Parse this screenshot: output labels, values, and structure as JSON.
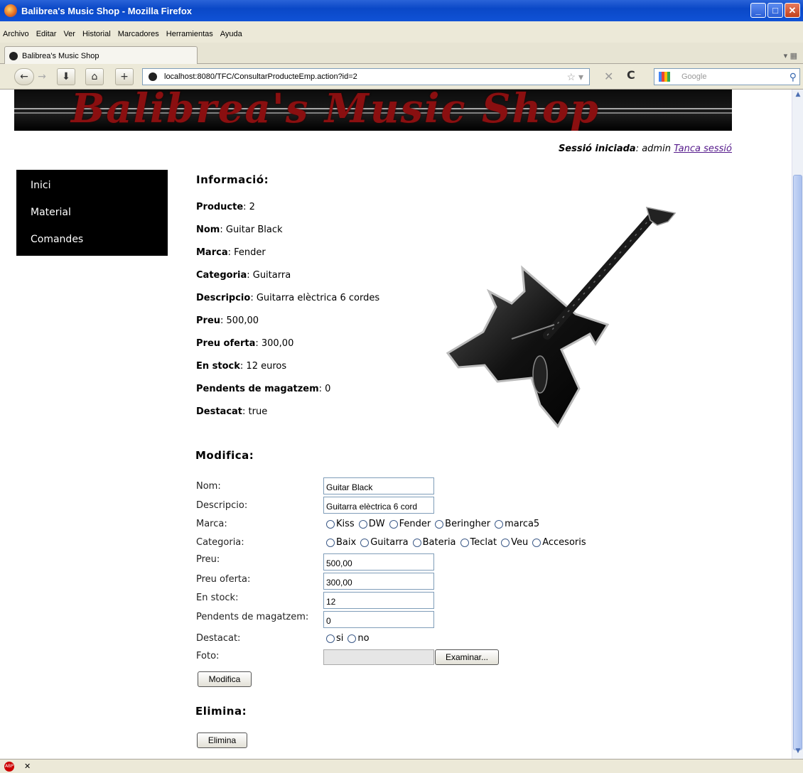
{
  "window": {
    "title": "Balibrea's Music Shop - Mozilla Firefox"
  },
  "menu": [
    "Archivo",
    "Editar",
    "Ver",
    "Historial",
    "Marcadores",
    "Herramientas",
    "Ayuda"
  ],
  "tab": {
    "label": "Balibrea's Music Shop"
  },
  "address": {
    "url": "localhost:8080/TFC/ConsultarProducteEmp.action?id=2"
  },
  "search": {
    "placeholder": "Google"
  },
  "banner": {
    "text": "Balibrea's Music Shop"
  },
  "session": {
    "label": "Sessió iniciada",
    "user": ": admin",
    "logout": "Tanca sessió"
  },
  "sidebar": {
    "items": [
      "Inici",
      "Material",
      "Comandes"
    ]
  },
  "info": {
    "heading": "Informació",
    "rows": [
      {
        "label": "Producte",
        "value": ": 2"
      },
      {
        "label": "Nom",
        "value": ": Guitar Black"
      },
      {
        "label": "Marca",
        "value": ": Fender"
      },
      {
        "label": "Categoria",
        "value": ": Guitarra"
      },
      {
        "label": "Descripcio",
        "value": ": Guitarra elèctrica 6 cordes"
      },
      {
        "label": "Preu",
        "value": ": 500,00"
      },
      {
        "label": "Preu oferta",
        "value": ": 300,00"
      },
      {
        "label": "En stock",
        "value": ": 12 euros"
      },
      {
        "label": "Pendents de magatzem",
        "value": ": 0"
      },
      {
        "label": "Destacat",
        "value": ": true"
      }
    ]
  },
  "modifica": {
    "heading": "Modifica",
    "nom_label": "Nom:",
    "nom_value": "Guitar Black",
    "desc_label": "Descripcio:",
    "desc_value": "Guitarra elèctrica 6 cord",
    "marca_label": "Marca:",
    "marca_options": [
      "Kiss",
      "DW",
      "Fender",
      "Beringher",
      "marca5"
    ],
    "cat_label": "Categoria:",
    "cat_options": [
      "Baix",
      "Guitarra",
      "Bateria",
      "Teclat",
      "Veu",
      "Accesoris"
    ],
    "preu_label": "Preu:",
    "preu_value": "500,00",
    "oferta_label": "Preu oferta:",
    "oferta_value": "300,00",
    "stock_label": "En stock:",
    "stock_value": "12",
    "pend_label": "Pendents de magatzem:",
    "pend_value": "0",
    "dest_label": "Destacat:",
    "dest_options": [
      "si",
      "no"
    ],
    "foto_label": "Foto:",
    "browse_label": "Examinar...",
    "submit_label": "Modifica"
  },
  "elimina": {
    "heading": "Elimina",
    "button_label": "Elimina"
  }
}
